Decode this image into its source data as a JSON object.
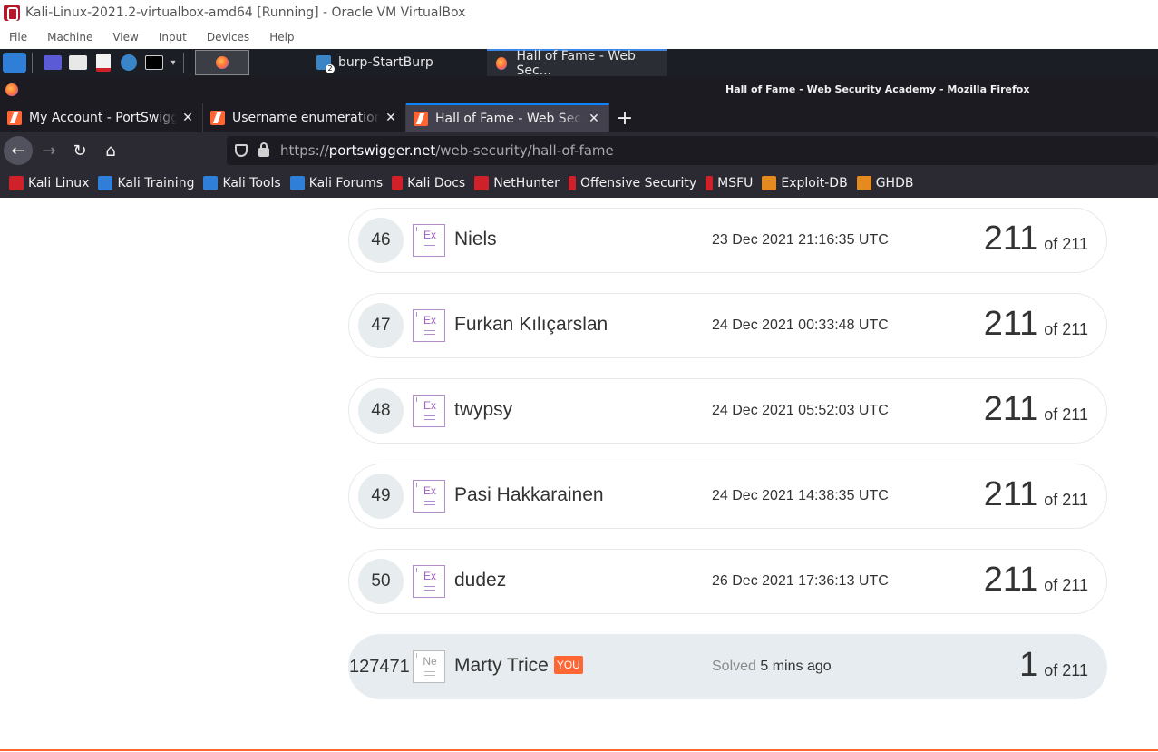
{
  "vbox": {
    "title": "Kali-Linux-2021.2-virtualbox-amd64 [Running] - Oracle VM VirtualBox",
    "menu": [
      "File",
      "Machine",
      "View",
      "Input",
      "Devices",
      "Help"
    ]
  },
  "panel": {
    "tasks": [
      {
        "label": "burp-StartBurp",
        "icon": "burp-icon"
      },
      {
        "label": "Hall of Fame - Web Sec...",
        "icon": "firefox-icon"
      }
    ]
  },
  "firefox": {
    "window_title": "Hall of Fame - Web Security Academy - Mozilla Firefox",
    "tabs": [
      {
        "label": "My Account - PortSwigger",
        "active": false
      },
      {
        "label": "Username enumeration via",
        "active": false
      },
      {
        "label": "Hall of Fame - Web Security",
        "active": true
      }
    ],
    "url": {
      "scheme": "https://",
      "host": "portswigger.net",
      "path": "/web-security/hall-of-fame"
    },
    "bookmarks": [
      {
        "label": "Kali Linux",
        "icon": "kali-icon",
        "color": "#d0202a"
      },
      {
        "label": "Kali Training",
        "icon": "kali-training-icon",
        "color": "#2f7fd8"
      },
      {
        "label": "Kali Tools",
        "icon": "kali-tools-icon",
        "color": "#2f7fd8"
      },
      {
        "label": "Kali Forums",
        "icon": "kali-forums-icon",
        "color": "#2f7fd8"
      },
      {
        "label": "Kali Docs",
        "icon": "kali-docs-icon",
        "color": "#d0202a"
      },
      {
        "label": "NetHunter",
        "icon": "nethunter-icon",
        "color": "#d0202a"
      },
      {
        "label": "Offensive Security",
        "icon": "offsec-icon",
        "color": "#d0202a"
      },
      {
        "label": "MSFU",
        "icon": "msfu-icon",
        "color": "#d0202a"
      },
      {
        "label": "Exploit-DB",
        "icon": "exploitdb-icon",
        "color": "#e58a1f"
      },
      {
        "label": "GHDB",
        "icon": "ghdb-icon",
        "color": "#e58a1f"
      }
    ]
  },
  "leaderboard": {
    "rows": [
      {
        "rank": "46",
        "badge": "Ex",
        "name": "Niels",
        "date": "23 Dec 2021 21:16:35 UTC",
        "score": "211",
        "of": "of 211"
      },
      {
        "rank": "47",
        "badge": "Ex",
        "name": "Furkan Kılıçarslan",
        "date": "24 Dec 2021 00:33:48 UTC",
        "score": "211",
        "of": "of 211"
      },
      {
        "rank": "48",
        "badge": "Ex",
        "name": "twypsy",
        "date": "24 Dec 2021 05:52:03 UTC",
        "score": "211",
        "of": "of 211"
      },
      {
        "rank": "49",
        "badge": "Ex",
        "name": "Pasi Hakkarainen",
        "date": "24 Dec 2021 14:38:35 UTC",
        "score": "211",
        "of": "of 211"
      },
      {
        "rank": "50",
        "badge": "Ex",
        "name": "dudez",
        "date": "26 Dec 2021 17:36:13 UTC",
        "score": "211",
        "of": "of 211"
      }
    ],
    "me": {
      "rank": "127471",
      "badge": "Ne",
      "name": "Marty Trice",
      "you": "YOU",
      "solved_label": "Solved",
      "solved_value": "5 mins ago",
      "score": "1",
      "of": "of 211"
    }
  },
  "colors": {
    "accent": "#ff6633",
    "badge_purple": "#9f5fbf",
    "row_me_bg": "#e6ecef"
  }
}
